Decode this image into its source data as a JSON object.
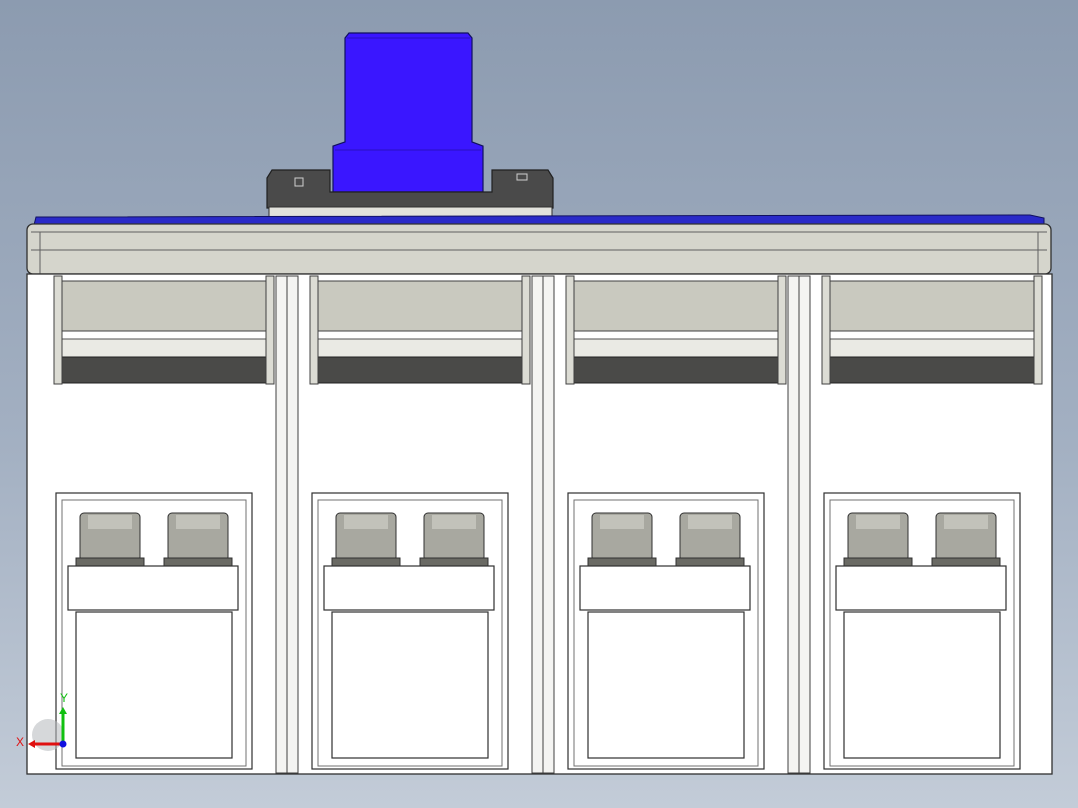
{
  "viewport": {
    "background_top": "#8c9bb0",
    "background_bottom": "#c3ccd8"
  },
  "model": {
    "handle_color": "#3a16ff",
    "body_color": "#ffffff",
    "top_strip_color": "#c9c9bf",
    "cover_color": "#d5d5cc",
    "pole_count": 4,
    "terminals_per_pole": 2
  },
  "triad": {
    "x_label": "X",
    "y_label": "Y",
    "x_color": "#e01010",
    "y_color": "#10c010",
    "z_color": "#1010e0"
  }
}
